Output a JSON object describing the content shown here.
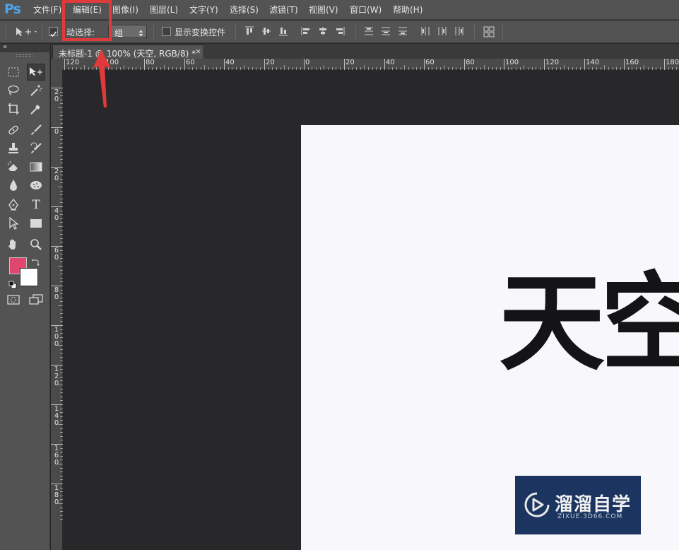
{
  "app": {
    "logo": "Ps"
  },
  "menu": [
    {
      "label": "文件(F)"
    },
    {
      "label": "编辑(E)"
    },
    {
      "label": "图像(I)"
    },
    {
      "label": "图层(L)"
    },
    {
      "label": "文字(Y)"
    },
    {
      "label": "选择(S)"
    },
    {
      "label": "滤镜(T)"
    },
    {
      "label": "视图(V)"
    },
    {
      "label": "窗口(W)"
    },
    {
      "label": "帮助(H)"
    }
  ],
  "options": {
    "auto_select_label": "动选择:",
    "auto_select_value": "组",
    "show_transform_label": "显示变换控件"
  },
  "document": {
    "tab_title": "未标题-1 @ 100% (天空, RGB/8) *",
    "close_glyph": "×",
    "text_content": "天空"
  },
  "ruler_top": [
    "120",
    "100",
    "80",
    "60",
    "40",
    "20",
    "0",
    "20",
    "40",
    "60",
    "80",
    "100",
    "120",
    "140",
    "160",
    "180"
  ],
  "ruler_left": [
    "20",
    "0",
    "20",
    "40",
    "60",
    "80",
    "100",
    "120",
    "140",
    "160",
    "180"
  ],
  "colors": {
    "foreground": "#e0476f",
    "background": "#ffffff",
    "highlight": "#e03a3a"
  },
  "watermark": {
    "title": "溜溜自学",
    "subtitle": "ZIXUE.3D66.COM"
  },
  "icons": {
    "move": "move-tool-icon",
    "marquee": "rect-marquee-icon",
    "lasso": "lasso-icon",
    "magic_wand": "magic-wand-icon",
    "crop": "crop-icon",
    "eyedropper": "eyedropper-icon",
    "healing": "healing-brush-icon",
    "brush": "brush-icon",
    "stamp": "clone-stamp-icon",
    "history_brush": "history-brush-icon",
    "eraser": "eraser-icon",
    "gradient": "gradient-icon",
    "blur": "blur-drop-icon",
    "sponge": "sponge-icon",
    "pen": "pen-icon",
    "type": "type-icon",
    "path_select": "path-select-icon",
    "shape": "rectangle-shape-icon",
    "hand": "hand-icon",
    "zoom": "zoom-icon",
    "quick_mask": "quick-mask-icon",
    "screen_mode": "screen-mode-icon"
  }
}
